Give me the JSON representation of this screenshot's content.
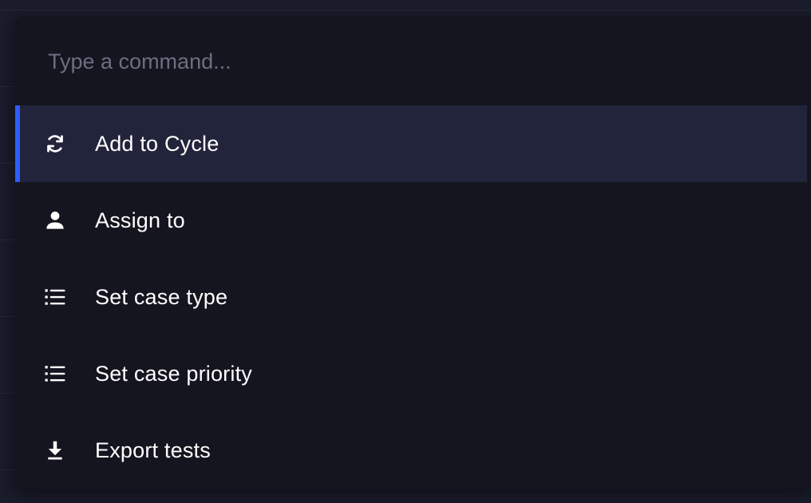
{
  "search": {
    "placeholder": "Type a command...",
    "value": ""
  },
  "commands": [
    {
      "label": "Add to Cycle",
      "icon": "cycle-icon",
      "active": true
    },
    {
      "label": "Assign to",
      "icon": "person-icon",
      "active": false
    },
    {
      "label": "Set case type",
      "icon": "list-icon",
      "active": false
    },
    {
      "label": "Set case priority",
      "icon": "list-icon",
      "active": false
    },
    {
      "label": "Export tests",
      "icon": "download-icon",
      "active": false
    }
  ],
  "colors": {
    "accent": "#2f5cff",
    "active_row": "#22243b",
    "panel": "#151520",
    "text": "#ffffff",
    "placeholder": "#6c6e80"
  }
}
